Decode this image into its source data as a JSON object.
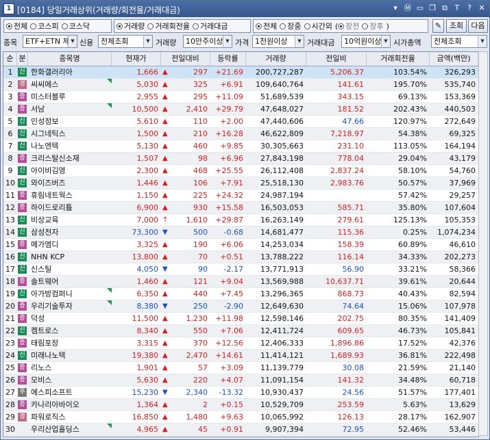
{
  "window": {
    "num": "1",
    "title": "[0184] 당일거래상위(거래량/회전율/거래대금)"
  },
  "titlebar_icons": [
    "arrow-down-icon",
    "m-icon",
    "window-icon",
    "restore-icon",
    "copy-icon",
    "T",
    "?",
    "close-icon"
  ],
  "filters": {
    "market": [
      "전체",
      "코스피",
      "코스닥"
    ],
    "market_sel": 0,
    "sort": [
      "거래량",
      "거래회전율",
      "거래대금"
    ],
    "sort_sel": 0,
    "session": [
      "전체",
      "장중",
      "시간외"
    ],
    "session_sel": 0,
    "session_sub": [
      "장전",
      "장후"
    ],
    "session_sub_sel": 0,
    "btn_query": "조회",
    "btn_next": "다음"
  },
  "row2": {
    "item_label": "종목",
    "item_value": "ETF+ETN 제",
    "credit_label": "신용",
    "credit_value": "전체조회",
    "volume_label": "거래량",
    "volume_value": "10만주이상",
    "price_label": "가격",
    "price_value": "1천원이상",
    "amount_label": "거래대금",
    "amount_value": "10억원이상",
    "cap_label": "시가총액",
    "cap_value": "전체조회"
  },
  "columns": [
    "순위",
    "분",
    "종목명",
    "현재가",
    "전일대비",
    "등락률",
    "거래량",
    "전일비",
    "거래회전율",
    "금액(백만)"
  ],
  "rows": [
    {
      "rank": "1",
      "type": "신",
      "name": "한화갤러리아",
      "price": "1,666",
      "dir": "up",
      "change": "297",
      "rate": "+21.69",
      "volume": "200,727,287",
      "prev": "5,206.37",
      "turnover": "103.54%",
      "amount": "326,293",
      "flag": false
    },
    {
      "rank": "2",
      "type": "경",
      "name": "씨씨에스",
      "price": "5,030",
      "dir": "up",
      "change": "325",
      "rate": "+6.91",
      "volume": "109,640,764",
      "prev": "141.61",
      "turnover": "195.70%",
      "amount": "535,740",
      "flag": true
    },
    {
      "rank": "3",
      "type": "증",
      "name": "미스터블루",
      "price": "2,955",
      "dir": "up",
      "change": "295",
      "rate": "+11.09",
      "volume": "51,689,539",
      "prev": "343.15",
      "turnover": "69.13%",
      "amount": "153,369",
      "flag": false
    },
    {
      "rank": "4",
      "type": "증",
      "name": "서남",
      "price": "10,500",
      "dir": "up",
      "change": "2,410",
      "rate": "+29.79",
      "volume": "47,648,027",
      "prev": "181.52",
      "turnover": "202.43%",
      "amount": "440,503",
      "flag": true
    },
    {
      "rank": "5",
      "type": "신",
      "name": "인성정보",
      "price": "5,610",
      "dir": "up",
      "change": "110",
      "rate": "+2.00",
      "volume": "47,440,606",
      "prev": "47.66",
      "turnover": "120.97%",
      "amount": "272,649",
      "flag": false
    },
    {
      "rank": "6",
      "type": "신",
      "name": "시그네틱스",
      "price": "1,500",
      "dir": "up",
      "change": "210",
      "rate": "+16.28",
      "volume": "46,622,809",
      "prev": "7,218.97",
      "turnover": "54.38%",
      "amount": "69,325",
      "flag": false
    },
    {
      "rank": "7",
      "type": "신",
      "name": "나노엔텍",
      "price": "5,130",
      "dir": "up",
      "change": "460",
      "rate": "+9.85",
      "volume": "30,305,663",
      "prev": "231.10",
      "turnover": "113.05%",
      "amount": "164,194",
      "flag": false
    },
    {
      "rank": "8",
      "type": "증",
      "name": "크리스탈신소재",
      "price": "1,507",
      "dir": "up",
      "change": "98",
      "rate": "+6.96",
      "volume": "27,843,198",
      "prev": "778.04",
      "turnover": "29.04%",
      "amount": "43,179",
      "flag": false
    },
    {
      "rank": "9",
      "type": "신",
      "name": "아이비김영",
      "price": "2,300",
      "dir": "up",
      "change": "468",
      "rate": "+25.55",
      "volume": "26,112,408",
      "prev": "2,837.24",
      "turnover": "58.10%",
      "amount": "54,760",
      "flag": false
    },
    {
      "rank": "10",
      "type": "신",
      "name": "와이즈버즈",
      "price": "1,446",
      "dir": "up",
      "change": "106",
      "rate": "+7.91",
      "volume": "25,518,130",
      "prev": "2,983.76",
      "turnover": "50.57%",
      "amount": "37,969",
      "flag": false
    },
    {
      "rank": "11",
      "type": "증",
      "name": "휴림네트웍스",
      "price": "1,150",
      "dir": "up",
      "change": "225",
      "rate": "+24.32",
      "volume": "24,987,194",
      "prev": "",
      "turnover": "57.42%",
      "amount": "29,257",
      "flag": false
    },
    {
      "rank": "12",
      "type": "증",
      "name": "하이드로리튬",
      "price": "6,900",
      "dir": "up",
      "change": "930",
      "rate": "+15.58",
      "volume": "16,503,053",
      "prev": "585.71",
      "turnover": "35.80%",
      "amount": "107,604",
      "flag": false
    },
    {
      "rank": "13",
      "type": "신",
      "name": "비상교육",
      "price": "7,000",
      "dir": "limit",
      "change": "1,610",
      "rate": "+29.87",
      "volume": "16,263,149",
      "prev": "279.61",
      "turnover": "125.13%",
      "amount": "105,353",
      "flag": false
    },
    {
      "rank": "14",
      "type": "신",
      "name": "삼성전자",
      "price": "73,300",
      "dir": "dn",
      "change": "500",
      "rate": "-0.68",
      "volume": "14,681,477",
      "prev": "115.36",
      "turnover": "0.25%",
      "amount": "1,074,234",
      "flag": false
    },
    {
      "rank": "15",
      "type": "증",
      "name": "메가엠디",
      "price": "3,325",
      "dir": "up",
      "change": "190",
      "rate": "+6.06",
      "volume": "14,253,034",
      "prev": "158.39",
      "turnover": "60.89%",
      "amount": "46,610",
      "flag": false
    },
    {
      "rank": "16",
      "type": "신",
      "name": "NHN KCP",
      "price": "13,800",
      "dir": "up",
      "change": "70",
      "rate": "+0.51",
      "volume": "13,788,222",
      "prev": "116.14",
      "turnover": "34.33%",
      "amount": "202,273",
      "flag": false
    },
    {
      "rank": "17",
      "type": "신",
      "name": "신스틸",
      "price": "4,050",
      "dir": "dn",
      "change": "90",
      "rate": "-2.17",
      "volume": "13,771,913",
      "prev": "56.90",
      "turnover": "33.21%",
      "amount": "58,366",
      "flag": false
    },
    {
      "rank": "18",
      "type": "증",
      "name": "솔트웨어",
      "price": "1,460",
      "dir": "up",
      "change": "121",
      "rate": "+9.04",
      "volume": "13,569,988",
      "prev": "10,637.71",
      "turnover": "39.61%",
      "amount": "20,644",
      "flag": false
    },
    {
      "rank": "19",
      "type": "신",
      "name": "아가방컴퍼니",
      "price": "6,350",
      "dir": "up",
      "change": "440",
      "rate": "+7.45",
      "volume": "13,296,365",
      "prev": "868.73",
      "turnover": "40.43%",
      "amount": "82,594",
      "flag": true
    },
    {
      "rank": "20",
      "type": "증",
      "name": "우리기술투자",
      "price": "8,380",
      "dir": "dn",
      "change": "250",
      "rate": "-2.90",
      "volume": "12,649,630",
      "prev": "74.64",
      "turnover": "15.06%",
      "amount": "107,978",
      "flag": true
    },
    {
      "rank": "21",
      "type": "증",
      "name": "덕성",
      "price": "11,500",
      "dir": "up",
      "change": "1,230",
      "rate": "+11.98",
      "volume": "12,598,146",
      "prev": "202.75",
      "turnover": "80.35%",
      "amount": "141,409",
      "flag": false
    },
    {
      "rank": "22",
      "type": "신",
      "name": "켐트로스",
      "price": "8,340",
      "dir": "up",
      "change": "550",
      "rate": "+7.06",
      "volume": "12,411,724",
      "prev": "609.65",
      "turnover": "46.73%",
      "amount": "105,841",
      "flag": false
    },
    {
      "rank": "23",
      "type": "증",
      "name": "태림포장",
      "price": "3,315",
      "dir": "up",
      "change": "370",
      "rate": "+12.56",
      "volume": "12,406,333",
      "prev": "1,896.86",
      "turnover": "17.52%",
      "amount": "42,376",
      "flag": false
    },
    {
      "rank": "24",
      "type": "신",
      "name": "미래나노텍",
      "price": "19,380",
      "dir": "up",
      "change": "2,470",
      "rate": "+14.61",
      "volume": "11,414,121",
      "prev": "1,689.93",
      "turnover": "36.81%",
      "amount": "222,498",
      "flag": false
    },
    {
      "rank": "25",
      "type": "증",
      "name": "리노스",
      "price": "1,901",
      "dir": "up",
      "change": "57",
      "rate": "+3.09",
      "volume": "11,139,779",
      "prev": "30.08",
      "turnover": "21.59%",
      "amount": "21,140",
      "flag": false
    },
    {
      "rank": "26",
      "type": "증",
      "name": "모비스",
      "price": "5,630",
      "dir": "up",
      "change": "220",
      "rate": "+4.07",
      "volume": "11,091,154",
      "prev": "141.32",
      "turnover": "34.48%",
      "amount": "60,718",
      "flag": false
    },
    {
      "rank": "27",
      "type": "주",
      "name": "에스피소프트",
      "price": "15,230",
      "dir": "dn",
      "change": "2,340",
      "rate": "-13.32",
      "volume": "10,930,437",
      "prev": "24.56",
      "turnover": "51.57%",
      "amount": "177,401",
      "flag": false
    },
    {
      "rank": "28",
      "type": "증",
      "name": "카나리아바이오",
      "price": "1,364",
      "dir": "up",
      "change": "2",
      "rate": "+0.15",
      "volume": "10,529,709",
      "prev": "253.59",
      "turnover": "5.63%",
      "amount": "13,629",
      "flag": false
    },
    {
      "rank": "29",
      "type": "경",
      "name": "파워로직스",
      "price": "16,850",
      "dir": "up",
      "change": "1,480",
      "rate": "+9.63",
      "volume": "10,065,992",
      "prev": "126.13",
      "turnover": "28.17%",
      "amount": "162,907",
      "flag": false
    },
    {
      "rank": "30",
      "type": "",
      "name": "우리산업홀딩스",
      "price": "4,965",
      "dir": "up",
      "change": "45",
      "rate": "+0.91",
      "volume": "9,907,394",
      "prev": "72.95",
      "turnover": "52.46%",
      "amount": "53,446",
      "flag": true
    }
  ],
  "colors": {
    "up": "#d21f1f",
    "down": "#1a50c8",
    "badge_신": "#1d8a5a",
    "badge_증": "#b0519a",
    "badge_경": "#c06a8a",
    "badge_주": "#7a7a7a",
    "selected_row": "#cfe3f6"
  }
}
